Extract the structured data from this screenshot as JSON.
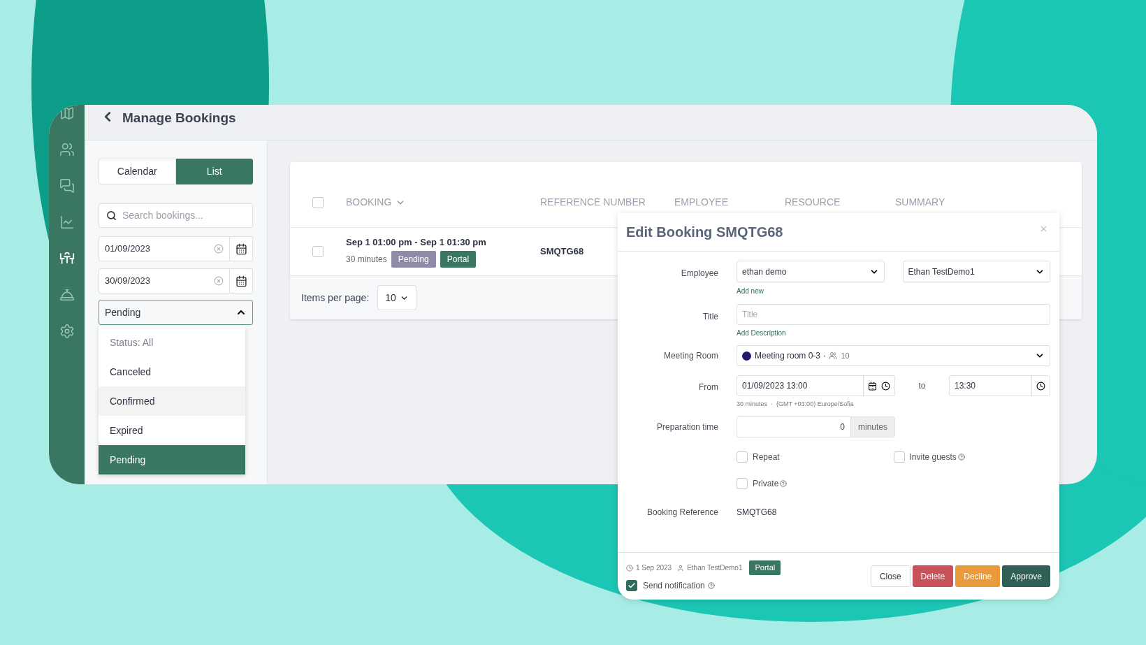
{
  "page": {
    "title": "Manage Bookings"
  },
  "sidebar": {
    "items": [
      {
        "selected": false
      },
      {
        "selected": false
      },
      {
        "selected": false
      },
      {
        "selected": false
      },
      {
        "selected": true
      },
      {
        "selected": false
      },
      {
        "selected": false
      }
    ]
  },
  "view_toggle": [
    {
      "label": "Calendar",
      "selected": false
    },
    {
      "label": "List",
      "selected": true
    }
  ],
  "filters": {
    "search": {
      "placeholder": "Search bookings..."
    },
    "date_from": "01/09/2023",
    "date_to": "30/09/2023",
    "status": {
      "value": "Pending",
      "expanded": true,
      "options": [
        {
          "label": "Status: All",
          "kind": "placeholder",
          "selected": false,
          "hovered": false
        },
        {
          "label": "Canceled",
          "kind": "option",
          "selected": false,
          "hovered": false
        },
        {
          "label": "Confirmed",
          "kind": "option",
          "selected": false,
          "hovered": true
        },
        {
          "label": "Expired",
          "kind": "option",
          "selected": false,
          "hovered": false
        },
        {
          "label": "Pending",
          "kind": "option",
          "selected": true,
          "hovered": false
        }
      ]
    }
  },
  "table": {
    "select_all": false,
    "columns": [
      "BOOKING",
      "REFERENCE NUMBER",
      "EMPLOYEE",
      "RESOURCE",
      "SUMMARY"
    ],
    "rows": [
      {
        "checked": false,
        "time": "Sep 1 01:00 pm - Sep 1 01:30 pm",
        "duration": "30 minutes",
        "tags": [
          {
            "label": "Pending",
            "color": "#8e8aa8"
          },
          {
            "label": "Portal",
            "color": "#3a7763"
          }
        ],
        "reference": "SMQTG68"
      }
    ],
    "items_per_page": {
      "label": "Items per page:",
      "value": "10"
    }
  },
  "modal": {
    "title": "Edit Booking SMQTG68",
    "employee": {
      "label": "Employee",
      "value": "ethan demo",
      "value2": "Ethan TestDemo1",
      "link": "Add new"
    },
    "title_field": {
      "label": "Title",
      "placeholder": "Title",
      "link": "Add Description"
    },
    "room": {
      "label": "Meeting Room",
      "color": "#1f1a6e",
      "name": "Meeting room 0-3 ·",
      "capacity": "10"
    },
    "from": {
      "label": "From",
      "value": "01/09/2023 13:00",
      "to_label": "to",
      "to_value": "13:30",
      "note": "30 minutes  ·  (GMT +03:00) Europe/Sofia"
    },
    "preparation": {
      "label": "Preparation time",
      "value": "0",
      "unit": "minutes"
    },
    "options": [
      {
        "label": "Repeat",
        "checked": false,
        "help": false
      },
      {
        "label": "Invite guests",
        "checked": false,
        "help": true
      },
      {
        "label": "Private",
        "checked": false,
        "help": true
      }
    ],
    "reference": {
      "label": "Booking Reference",
      "value": "SMQTG68"
    },
    "meta": {
      "date": "1 Sep 2023",
      "user": "Ethan TestDemo1",
      "tag": "Portal"
    },
    "send_notification": {
      "label": "Send notification",
      "checked": true
    },
    "buttons": [
      {
        "label": "Close",
        "kind": "default"
      },
      {
        "label": "Delete",
        "kind": "danger"
      },
      {
        "label": "Decline",
        "kind": "warning"
      },
      {
        "label": "Approve",
        "kind": "primary"
      }
    ]
  }
}
